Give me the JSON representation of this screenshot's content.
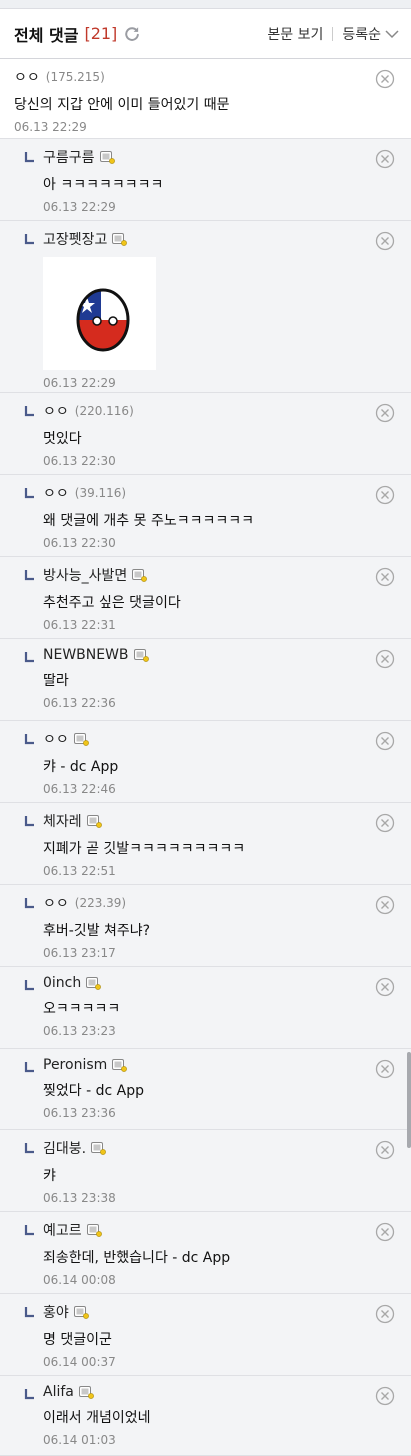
{
  "header": {
    "title": "전체 댓글",
    "count": "[21]",
    "view_post": "본문 보기",
    "sort": "등록순"
  },
  "comments": [
    {
      "nick": "ㅇㅇ",
      "ip": "(175.215)",
      "text": "당신의 지갑 안에 이미 들어있기 때문",
      "date": "06.13 22:29",
      "reply": false,
      "badge": false
    },
    {
      "nick": "구름구름",
      "ip": "",
      "text": "아 ㅋㅋㅋㅋㅋㅋㅋㅋ",
      "date": "06.13 22:29",
      "reply": true,
      "badge": true
    },
    {
      "nick": "고장펫장고",
      "ip": "",
      "text": "",
      "date": "06.13 22:29",
      "reply": true,
      "badge": true,
      "image": true
    },
    {
      "nick": "ㅇㅇ",
      "ip": "(220.116)",
      "text": "멋있다",
      "date": "06.13 22:30",
      "reply": true,
      "badge": false
    },
    {
      "nick": "ㅇㅇ",
      "ip": "(39.116)",
      "text": "왜 댓글에 개추 못 주노ㅋㅋㅋㅋㅋㅋ",
      "date": "06.13 22:30",
      "reply": true,
      "badge": false
    },
    {
      "nick": "방사능_사발면",
      "ip": "",
      "text": "추천주고 싶은 댓글이다",
      "date": "06.13 22:31",
      "reply": true,
      "badge": true
    },
    {
      "nick": "NEWBNEWB",
      "ip": "",
      "text": "딸라",
      "date": "06.13 22:36",
      "reply": true,
      "badge": true
    },
    {
      "nick": "ㅇㅇ",
      "ip": "",
      "text": "캬 - dc App",
      "date": "06.13 22:46",
      "reply": true,
      "badge": true
    },
    {
      "nick": "체자레",
      "ip": "",
      "text": "지폐가 곧 깃발ㅋㅋㅋㅋㅋㅋㅋㅋㅋ",
      "date": "06.13 22:51",
      "reply": true,
      "badge": true
    },
    {
      "nick": "ㅇㅇ",
      "ip": "(223.39)",
      "text": "후버-깃발 쳐주냐?",
      "date": "06.13 23:17",
      "reply": true,
      "badge": false
    },
    {
      "nick": "0inch",
      "ip": "",
      "text": "오ㅋㅋㅋㅋㅋ",
      "date": "06.13 23:23",
      "reply": true,
      "badge": true
    },
    {
      "nick": "Peronism",
      "ip": "",
      "text": "찢었다 - dc App",
      "date": "06.13 23:36",
      "reply": true,
      "badge": true
    },
    {
      "nick": "김대붕.",
      "ip": "",
      "text": "캬",
      "date": "06.13 23:38",
      "reply": true,
      "badge": true
    },
    {
      "nick": "예고르",
      "ip": "",
      "text": "죄송한데, 반했습니다 - dc App",
      "date": "06.14 00:08",
      "reply": true,
      "badge": true
    },
    {
      "nick": "홍야",
      "ip": "",
      "text": "명 댓글이군",
      "date": "06.14 00:37",
      "reply": true,
      "badge": true
    },
    {
      "nick": "Alifa",
      "ip": "",
      "text": "이래서 개념이었네",
      "date": "06.14 01:03",
      "reply": true,
      "badge": true
    }
  ],
  "colors": {
    "accent": "#c0392b",
    "reply_bg": "#f3f4f6",
    "reply_icon": "#4a5a8a"
  }
}
